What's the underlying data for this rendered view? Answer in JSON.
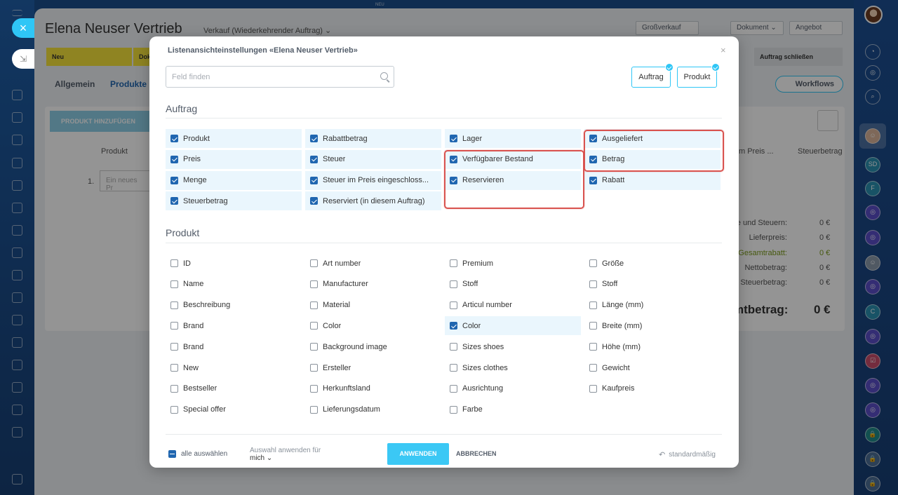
{
  "background": {
    "title": "Elena Neuser Vertrieb",
    "subtitle": "Verkauf (Wiederkehrender Auftrag) ⌄",
    "header_buttons": [
      "Großverkauf",
      "Dokument ⌄",
      "Angebot"
    ],
    "stages": [
      "Neu",
      "Dok",
      "Auftrag schließen"
    ],
    "tabs": [
      "Allgemein",
      "Produkte"
    ],
    "workflows_label": "Workflows",
    "add_product_label": "PRODUKT HINZUFÜGEN",
    "table_product_header": "Produkt",
    "row_number": "1.",
    "new_product_placeholder": "Ein neues Pr",
    "header_price_partial": "m Preis ...",
    "header_tax_amount": "Steuerbetrag",
    "totals": [
      {
        "label": "e und Steuern:",
        "value": "0 €"
      },
      {
        "label": "Lieferpreis:",
        "value": "0 €"
      },
      {
        "label": "Gesamtrabatt:",
        "value": "0 €"
      },
      {
        "label": "Nettobetrag:",
        "value": "0 €"
      },
      {
        "label": "Steuerbetrag:",
        "value": "0 €"
      }
    ],
    "grand_total_label": "mtbetrag:",
    "grand_total_value": "0 €",
    "top_badge": "NEU"
  },
  "dialog": {
    "title": "Listenansichteinstellungen «Elena Neuser Vertrieb»",
    "search_placeholder": "Feld finden",
    "entity_buttons": [
      "Auftrag",
      "Produkt"
    ],
    "sections": [
      {
        "title": "Auftrag",
        "fields": [
          {
            "label": "Produkt",
            "checked": true
          },
          {
            "label": "Rabattbetrag",
            "checked": true
          },
          {
            "label": "Lager",
            "checked": true
          },
          {
            "label": "Ausgeliefert",
            "checked": true
          },
          {
            "label": "Preis",
            "checked": true
          },
          {
            "label": "Steuer",
            "checked": true
          },
          {
            "label": "Verfügbarer Bestand",
            "checked": true
          },
          {
            "label": "Betrag",
            "checked": true
          },
          {
            "label": "Menge",
            "checked": true
          },
          {
            "label": "Steuer im Preis eingeschloss...",
            "checked": true
          },
          {
            "label": "Reservieren",
            "checked": true
          },
          {
            "label": "Rabatt",
            "checked": true
          },
          {
            "label": "Steuerbetrag",
            "checked": true
          },
          {
            "label": "Reserviert (in diesem Auftrag)",
            "checked": true
          }
        ]
      },
      {
        "title": "Produkt",
        "fields": [
          {
            "label": "ID",
            "checked": false
          },
          {
            "label": "Art number",
            "checked": false
          },
          {
            "label": "Premium",
            "checked": false
          },
          {
            "label": "Größe",
            "checked": false
          },
          {
            "label": "Name",
            "checked": false
          },
          {
            "label": "Manufacturer",
            "checked": false
          },
          {
            "label": "Stoff",
            "checked": false
          },
          {
            "label": "Stoff",
            "checked": false
          },
          {
            "label": "Beschreibung",
            "checked": false
          },
          {
            "label": "Material",
            "checked": false
          },
          {
            "label": "Articul number",
            "checked": false
          },
          {
            "label": "Länge (mm)",
            "checked": false
          },
          {
            "label": "Brand",
            "checked": false
          },
          {
            "label": "Color",
            "checked": false
          },
          {
            "label": "Color",
            "checked": true
          },
          {
            "label": "Breite (mm)",
            "checked": false
          },
          {
            "label": "Brand",
            "checked": false
          },
          {
            "label": "Background image",
            "checked": false
          },
          {
            "label": "Sizes shoes",
            "checked": false
          },
          {
            "label": "Höhe (mm)",
            "checked": false
          },
          {
            "label": "New",
            "checked": false
          },
          {
            "label": "Ersteller",
            "checked": false
          },
          {
            "label": "Sizes clothes",
            "checked": false
          },
          {
            "label": "Gewicht",
            "checked": false
          },
          {
            "label": "Bestseller",
            "checked": false
          },
          {
            "label": "Herkunftsland",
            "checked": false
          },
          {
            "label": "Ausrichtung",
            "checked": false
          },
          {
            "label": "Kaufpreis",
            "checked": false
          },
          {
            "label": "Special offer",
            "checked": false
          },
          {
            "label": "Lieferungsdatum",
            "checked": false
          },
          {
            "label": "Farbe",
            "checked": false
          }
        ]
      }
    ],
    "footer": {
      "select_all_label": "alle auswählen",
      "apply_for_label": "Auswahl anwenden für",
      "apply_for_value": "mich ⌄",
      "apply_button": "ANWENDEN",
      "cancel_button": "ABBRECHEN",
      "default_button": "standardmäßig"
    }
  },
  "colors": {
    "accent": "#2fc6f6",
    "checkbox": "#2066b0",
    "highlight": "#d9534f"
  }
}
